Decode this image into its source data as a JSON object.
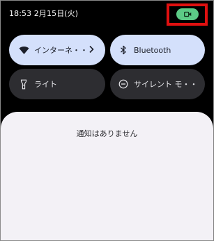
{
  "status_bar": {
    "clock": "18:53 2月15日(火)",
    "camera_indicator_icon": "videocam-icon",
    "indicator_color": "#5ccb86",
    "highlight_color": "#e01010"
  },
  "quick_settings": {
    "tiles": [
      {
        "label": "インターネ・・",
        "icon": "wifi-icon",
        "state": "on",
        "has_chevron": true
      },
      {
        "label": "Bluetooth",
        "icon": "bluetooth-icon",
        "state": "on"
      },
      {
        "label": "ライト",
        "icon": "flashlight-icon",
        "state": "off"
      },
      {
        "label": "サイレント モ・・",
        "icon": "do-not-disturb-icon",
        "state": "off"
      }
    ]
  },
  "notifications": {
    "empty_message": "通知はありません"
  }
}
